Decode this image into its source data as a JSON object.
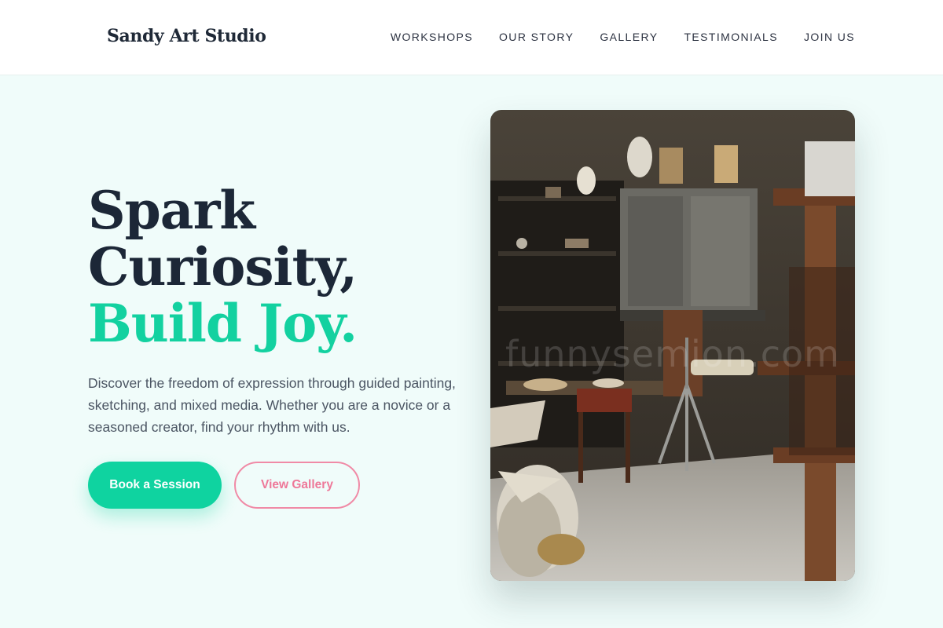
{
  "brand": {
    "name": "Sandy Art Studio"
  },
  "nav": {
    "items": [
      {
        "label": "WORKSHOPS"
      },
      {
        "label": "OUR STORY"
      },
      {
        "label": "GALLERY"
      },
      {
        "label": "TESTIMONIALS"
      },
      {
        "label": "JOIN US"
      }
    ]
  },
  "hero": {
    "title_line1": "Spark",
    "title_line2": "Curiosity,",
    "title_line3": "Build Joy.",
    "description": "Discover the freedom of expression through guided painting, sketching, and mixed media. Whether you are a novice or a seasoned creator, find your rhythm with us.",
    "primary_button": "Book a Session",
    "secondary_button": "View Gallery",
    "image_watermark": "funnysemion.com"
  },
  "colors": {
    "accent": "#13d1a0",
    "button_primary": "#0fd3a0",
    "button_secondary": "#ee7899",
    "heading": "#1c2737",
    "background": "#f0fcfa"
  }
}
